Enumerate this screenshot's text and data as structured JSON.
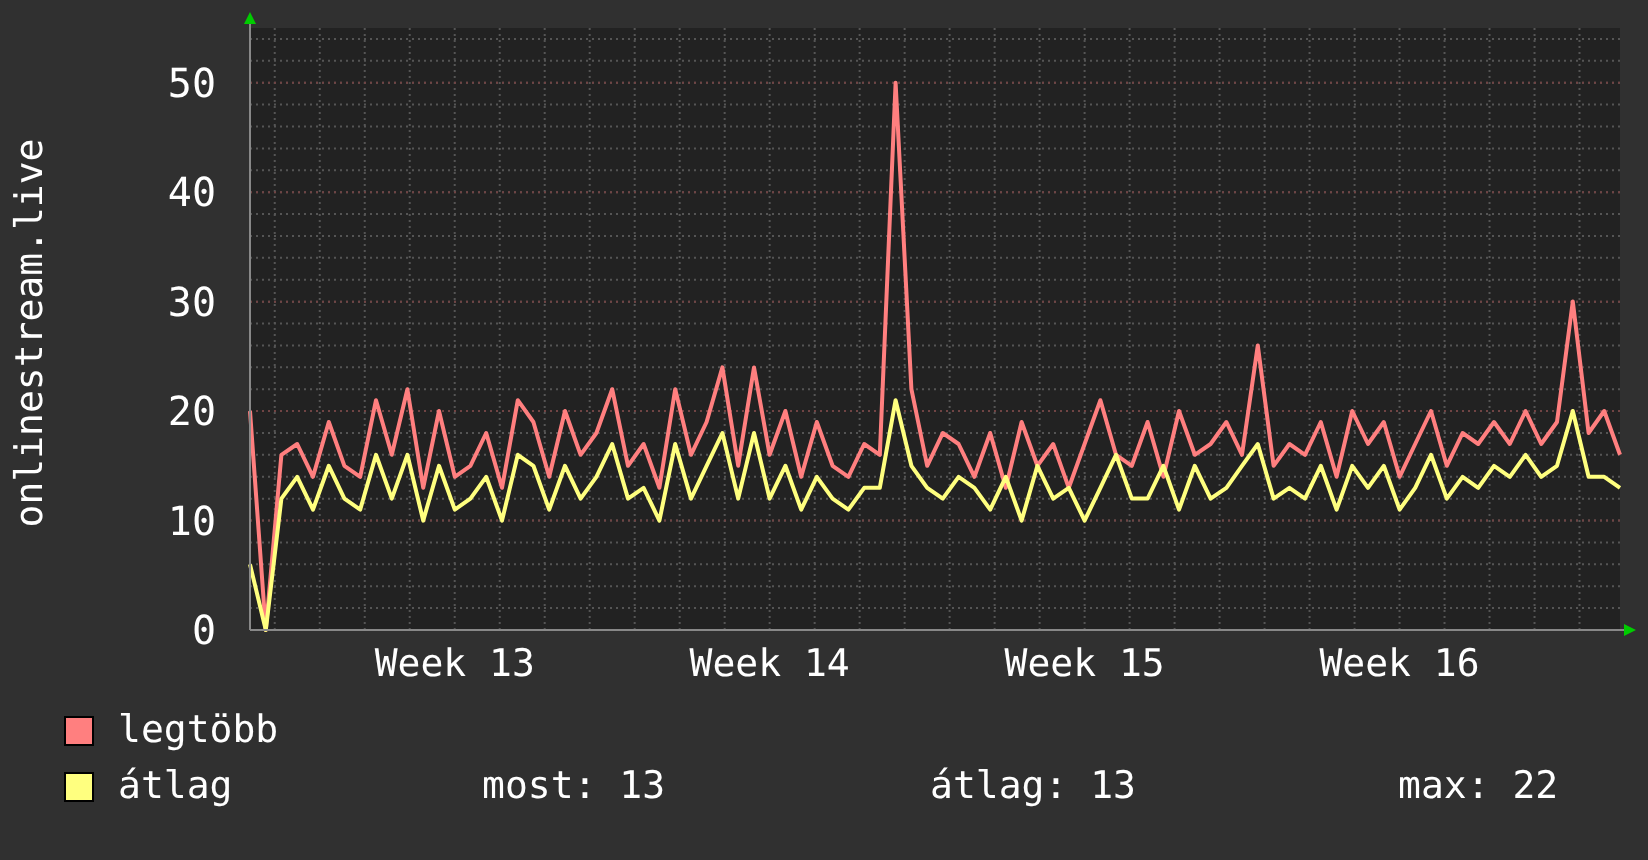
{
  "chart_data": {
    "type": "line",
    "grid": true,
    "ylabel": "onlinestream.live",
    "ylim": [
      0,
      55
    ],
    "yticks": [
      0,
      10,
      20,
      30,
      40,
      50
    ],
    "categories": [
      null,
      null,
      null,
      null,
      null,
      null,
      null,
      null,
      null,
      null,
      null,
      null,
      null,
      "Week 13",
      null,
      null,
      null,
      null,
      null,
      null,
      null,
      null,
      null,
      null,
      null,
      null,
      null,
      null,
      null,
      null,
      null,
      null,
      null,
      "Week 14",
      null,
      null,
      null,
      null,
      null,
      null,
      null,
      null,
      null,
      null,
      null,
      null,
      null,
      null,
      null,
      null,
      null,
      null,
      null,
      "Week 15",
      null,
      null,
      null,
      null,
      null,
      null,
      null,
      null,
      null,
      null,
      null,
      null,
      null,
      null,
      null,
      null,
      null,
      null,
      null,
      "Week 16",
      null,
      null,
      null,
      null,
      null,
      null,
      null,
      null,
      null,
      null,
      null,
      null,
      null,
      null
    ],
    "series": [
      {
        "name": "legtöbb",
        "color": "#ff7f7f",
        "values": [
          20,
          0,
          16,
          17,
          14,
          19,
          15,
          14,
          21,
          16,
          22,
          13,
          20,
          14,
          15,
          18,
          13,
          21,
          19,
          14,
          20,
          16,
          18,
          22,
          15,
          17,
          13,
          22,
          16,
          19,
          24,
          15,
          24,
          16,
          20,
          14,
          19,
          15,
          14,
          17,
          16,
          50,
          22,
          15,
          18,
          17,
          14,
          18,
          13,
          19,
          15,
          17,
          13,
          17,
          21,
          16,
          15,
          19,
          14,
          20,
          16,
          17,
          19,
          16,
          26,
          15,
          17,
          16,
          19,
          14,
          20,
          17,
          19,
          14,
          17,
          20,
          15,
          18,
          17,
          19,
          17,
          20,
          17,
          19,
          30,
          18,
          20,
          16
        ]
      },
      {
        "name": "átlag",
        "color": "#ffff7f",
        "values": [
          6,
          0,
          12,
          14,
          11,
          15,
          12,
          11,
          16,
          12,
          16,
          10,
          15,
          11,
          12,
          14,
          10,
          16,
          15,
          11,
          15,
          12,
          14,
          17,
          12,
          13,
          10,
          17,
          12,
          15,
          18,
          12,
          18,
          12,
          15,
          11,
          14,
          12,
          11,
          13,
          13,
          21,
          15,
          13,
          12,
          14,
          13,
          11,
          14,
          10,
          15,
          12,
          13,
          10,
          13,
          16,
          12,
          12,
          15,
          11,
          15,
          12,
          13,
          15,
          17,
          12,
          13,
          12,
          15,
          11,
          15,
          13,
          15,
          11,
          13,
          16,
          12,
          14,
          13,
          15,
          14,
          16,
          14,
          15,
          20,
          14,
          14,
          13
        ]
      }
    ]
  },
  "stats": [
    "most: 13",
    "átlag: 13",
    "max: 22"
  ]
}
